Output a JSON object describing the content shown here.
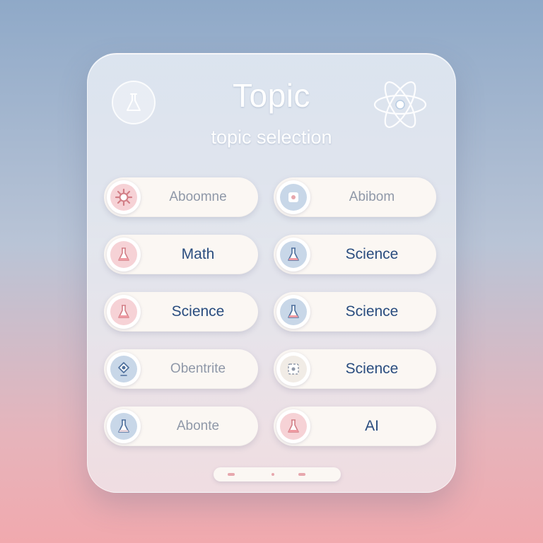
{
  "header": {
    "title": "Topic",
    "subtitle": "topic selection",
    "left_icon": "flask-icon",
    "right_icon": "atom-icon"
  },
  "topics": [
    {
      "label": "Aboomne",
      "icon": "gear-icon",
      "tint": "pink",
      "faded": true
    },
    {
      "label": "Abibom",
      "icon": "square-icon",
      "tint": "blue",
      "faded": true
    },
    {
      "label": "Math",
      "icon": "flask-icon",
      "tint": "pink",
      "faded": false
    },
    {
      "label": "Science",
      "icon": "flask-icon",
      "tint": "blue",
      "faded": false
    },
    {
      "label": "Science",
      "icon": "flask-icon",
      "tint": "pink",
      "faded": false
    },
    {
      "label": "Science",
      "icon": "flask-icon",
      "tint": "blue",
      "faded": false
    },
    {
      "label": "Obentrite",
      "icon": "bulb-icon",
      "tint": "blue",
      "faded": true
    },
    {
      "label": "Science",
      "icon": "puzzle-icon",
      "tint": "blue",
      "faded": false
    },
    {
      "label": "Abonte",
      "icon": "flask-icon",
      "tint": "blue",
      "faded": true
    },
    {
      "label": "AI",
      "icon": "flask-icon",
      "tint": "pink",
      "faded": false
    }
  ],
  "colors": {
    "accent_text": "#2a4d7f",
    "pink_tint": "#f6d2d6",
    "blue_tint": "#c8d7e8",
    "pill_bg": "#fbf7f3"
  }
}
